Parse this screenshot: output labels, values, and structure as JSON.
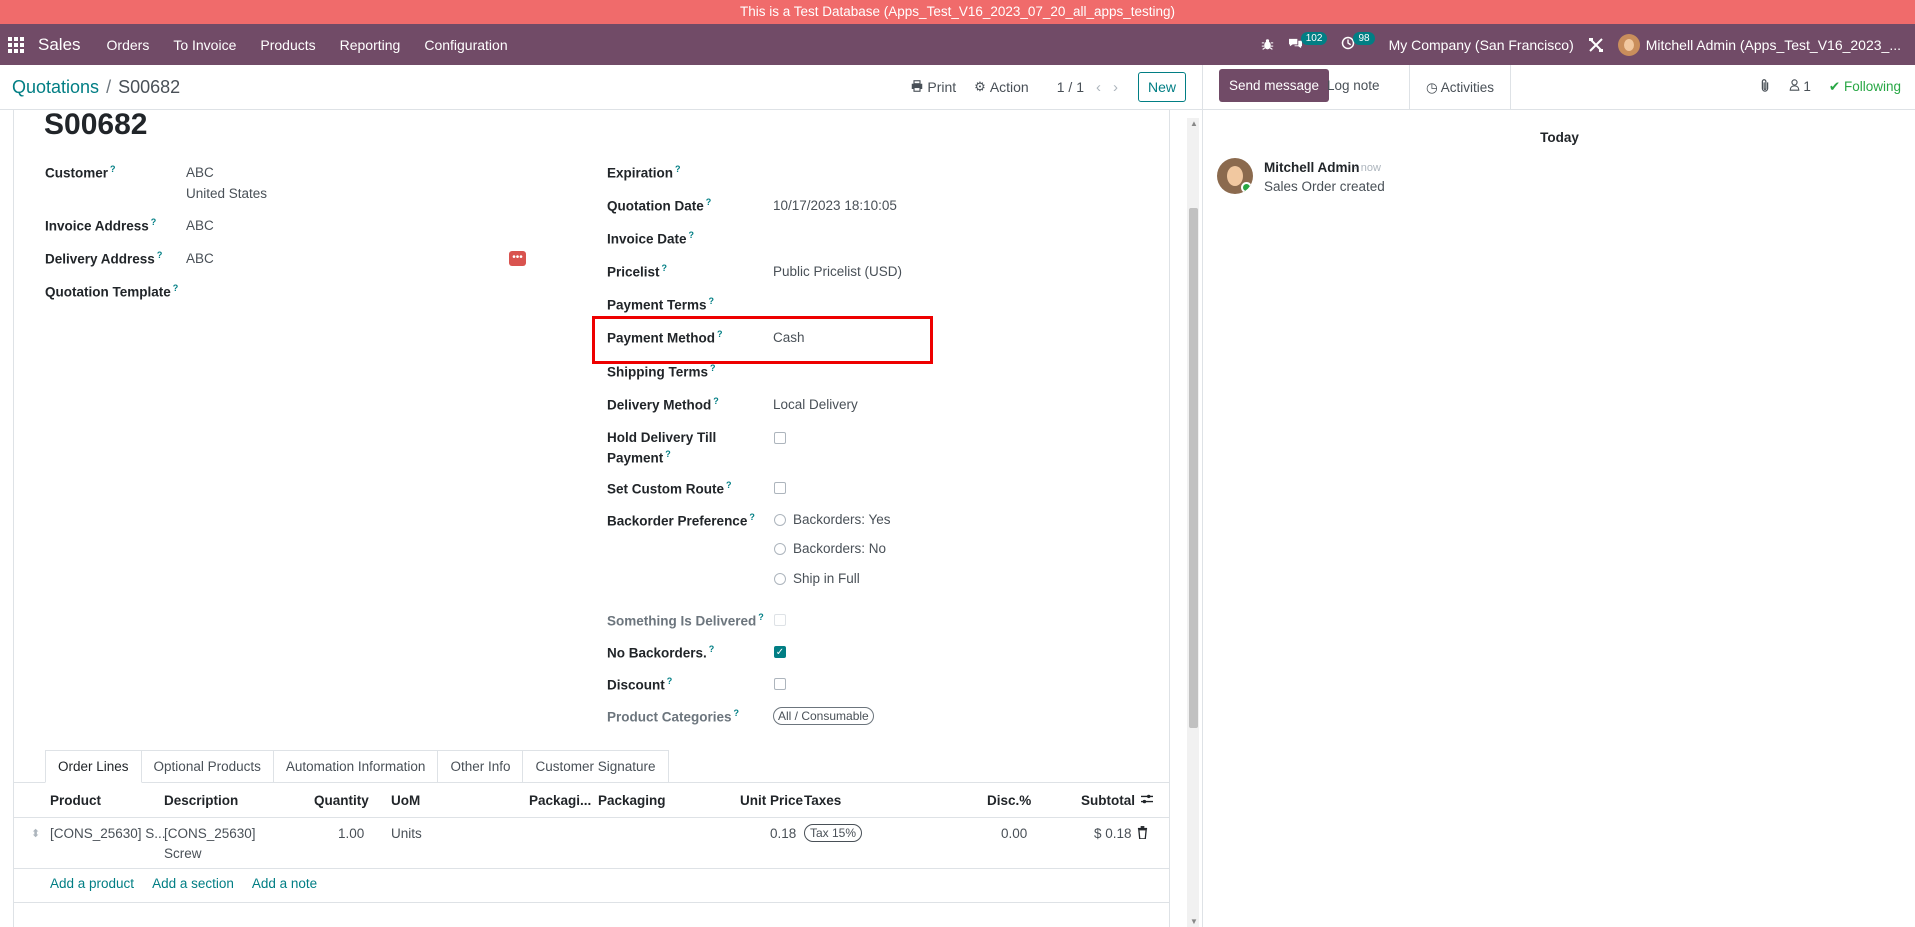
{
  "banner": "This is a Test Database (Apps_Test_V16_2023_07_20_all_apps_testing)",
  "navbar": {
    "app": "Sales",
    "menu": [
      "Orders",
      "To Invoice",
      "Products",
      "Reporting",
      "Configuration"
    ],
    "messages_count": "102",
    "activities_count": "98",
    "company": "My Company (San Francisco)",
    "user": "Mitchell Admin (Apps_Test_V16_2023_..."
  },
  "control_panel": {
    "breadcrumb_parent": "Quotations",
    "breadcrumb_sep": "/",
    "breadcrumb_current": "S00682",
    "print": "Print",
    "action": "Action",
    "pager": "1 / 1",
    "new": "New"
  },
  "form": {
    "title": "S00682",
    "left": {
      "customer_label": "Customer",
      "customer_name": "ABC",
      "customer_country": "United States",
      "invoice_address_label": "Invoice Address",
      "invoice_address": "ABC",
      "delivery_address_label": "Delivery Address",
      "delivery_address": "ABC",
      "quotation_template_label": "Quotation Template"
    },
    "right": {
      "expiration_label": "Expiration",
      "quotation_date_label": "Quotation Date",
      "quotation_date": "10/17/2023 18:10:05",
      "invoice_date_label": "Invoice Date",
      "pricelist_label": "Pricelist",
      "pricelist": "Public Pricelist (USD)",
      "payment_terms_label": "Payment Terms",
      "payment_method_label": "Payment Method",
      "payment_method": "Cash",
      "shipping_terms_label": "Shipping Terms",
      "delivery_method_label": "Delivery Method",
      "delivery_method": "Local Delivery",
      "hold_delivery_label_1": "Hold Delivery Till",
      "hold_delivery_label_2": "Payment",
      "set_custom_route_label": "Set Custom Route",
      "backorder_pref_label": "Backorder Preference",
      "backorder_options": [
        "Backorders: Yes",
        "Backorders: No",
        "Ship in Full"
      ],
      "something_delivered_label": "Something Is Delivered",
      "no_backorders_label": "No Backorders.",
      "discount_label": "Discount",
      "product_categories_label": "Product Categories",
      "product_category_tag": "All / Consumable"
    }
  },
  "tabs": [
    "Order Lines",
    "Optional Products",
    "Automation Information",
    "Other Info",
    "Customer Signature"
  ],
  "table": {
    "headers": {
      "product": "Product",
      "description": "Description",
      "quantity": "Quantity",
      "uom": "UoM",
      "packaging_qty": "Packagi...",
      "packaging": "Packaging",
      "unit_price": "Unit Price",
      "taxes": "Taxes",
      "disc": "Disc.%",
      "subtotal": "Subtotal"
    },
    "row": {
      "product": "[CONS_25630] S...",
      "description_1": "[CONS_25630]",
      "description_2": "Screw",
      "quantity": "1.00",
      "uom": "Units",
      "unit_price": "0.18",
      "taxes": "Tax 15%",
      "disc": "0.00",
      "subtotal": "$ 0.18"
    },
    "add_product": "Add a product",
    "add_section": "Add a section",
    "add_note": "Add a note"
  },
  "chatter": {
    "send_message": "Send message",
    "log_note": "Log note",
    "activities": "Activities",
    "followers_count": "1",
    "following": "Following",
    "today": "Today",
    "author": "Mitchell Admin",
    "time": "- now",
    "body": "Sales Order created"
  },
  "colors": {
    "brand": "#714b67",
    "accent": "#017e84",
    "banner": "#f06b6b",
    "highlight": "#ee0000"
  }
}
